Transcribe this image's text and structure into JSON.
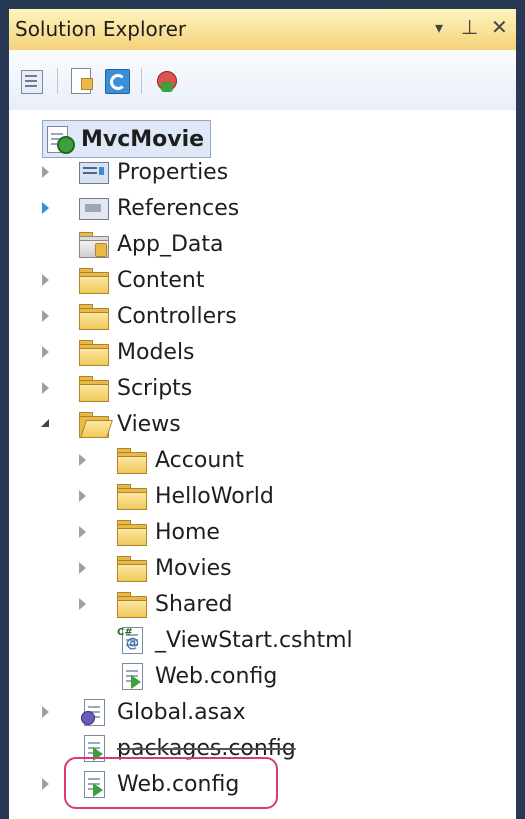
{
  "window": {
    "title": "Solution Explorer",
    "buttons": {
      "dropdown": "▾",
      "pin": "⊥",
      "close": "✕"
    }
  },
  "toolbar": {
    "tools": [
      "properties-icon",
      "show-all-files-icon",
      "refresh-icon",
      "view-class-diagram-icon"
    ]
  },
  "tree": {
    "project": {
      "label": "MvcMovie"
    },
    "items": {
      "properties": "Properties",
      "references": "References",
      "app_data": "App_Data",
      "content": "Content",
      "controllers": "Controllers",
      "models": "Models",
      "scripts": "Scripts",
      "views": "Views",
      "account": "Account",
      "helloworld": "HelloWorld",
      "home": "Home",
      "movies": "Movies",
      "shared": "Shared",
      "viewstart": "_ViewStart.cshtml",
      "views_webconfig": "Web.config",
      "global": "Global.asax",
      "packages": "packages.config",
      "root_webconfig": "Web.config"
    }
  },
  "colors": {
    "frame": "#293955",
    "highlight": "#d63b77",
    "folder": "#e9b94a"
  }
}
